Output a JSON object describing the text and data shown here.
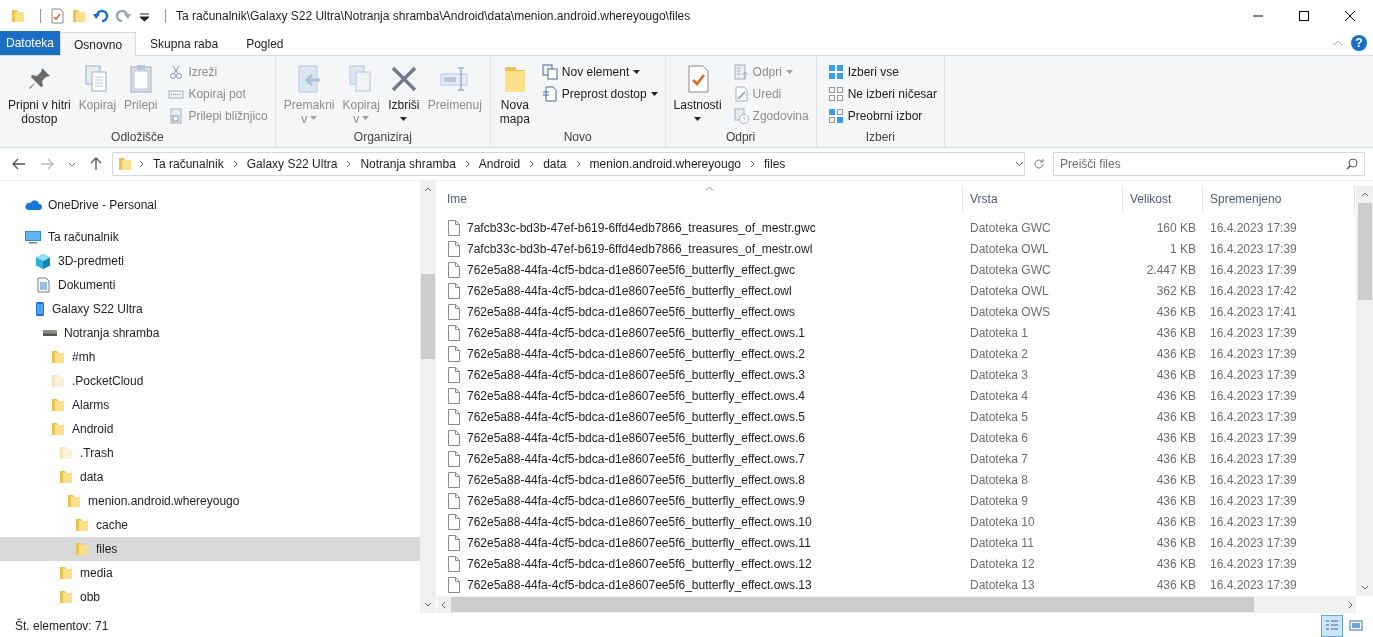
{
  "window": {
    "title": "Ta računalnik\\Galaxy S22 Ultra\\Notranja shramba\\Android\\data\\menion.android.whereyougo\\files"
  },
  "ribbon": {
    "tabs": [
      {
        "label": "Datoteka",
        "kind": "menu",
        "selected": false
      },
      {
        "label": "Osnovno",
        "kind": "tab",
        "selected": true
      },
      {
        "label": "Skupna raba",
        "kind": "tab",
        "selected": false
      },
      {
        "label": "Pogled",
        "kind": "tab",
        "selected": false
      }
    ],
    "help": "?",
    "groups": [
      {
        "label": "Odložišče",
        "items": [
          {
            "label": "Pripni v hitri\ndostop",
            "kind": "large",
            "disabled": false,
            "dropdown": false
          },
          {
            "label": "Kopiraj",
            "kind": "large",
            "disabled": true,
            "dropdown": false
          },
          {
            "label": "Prilepi",
            "kind": "large",
            "disabled": true,
            "dropdown": false
          },
          {
            "label": "Izreži",
            "kind": "small",
            "disabled": true,
            "dropdown": false
          },
          {
            "label": "Kopiraj pot",
            "kind": "small",
            "disabled": true,
            "dropdown": false
          },
          {
            "label": "Prilepi bližnjico",
            "kind": "small",
            "disabled": true,
            "dropdown": false
          }
        ]
      },
      {
        "label": "Organiziraj",
        "items": [
          {
            "label": "Premakni\nv",
            "kind": "large",
            "disabled": true,
            "dropdown": true
          },
          {
            "label": "Kopiraj\nv",
            "kind": "large",
            "disabled": true,
            "dropdown": true
          },
          {
            "label": "Izbriši",
            "kind": "large",
            "disabled": false,
            "dropdown": true
          },
          {
            "label": "Preimenuj",
            "kind": "large",
            "disabled": true,
            "dropdown": false
          }
        ]
      },
      {
        "label": "Novo",
        "items": [
          {
            "label": "Nova\nmapa",
            "kind": "large",
            "disabled": false,
            "dropdown": false
          },
          {
            "label": "Nov element",
            "kind": "small",
            "disabled": false,
            "dropdown": true
          },
          {
            "label": "Preprost dostop",
            "kind": "small",
            "disabled": false,
            "dropdown": true
          }
        ]
      },
      {
        "label": "Odpri",
        "items": [
          {
            "label": "Lastnosti",
            "kind": "large",
            "disabled": false,
            "dropdown": true
          },
          {
            "label": "Odpri",
            "kind": "small",
            "disabled": true,
            "dropdown": true
          },
          {
            "label": "Uredi",
            "kind": "small",
            "disabled": true,
            "dropdown": false
          },
          {
            "label": "Zgodovina",
            "kind": "small",
            "disabled": true,
            "dropdown": false
          }
        ]
      },
      {
        "label": "Izberi",
        "items": [
          {
            "label": "Izberi vse",
            "kind": "small",
            "disabled": false,
            "dropdown": false
          },
          {
            "label": "Ne izberi ničesar",
            "kind": "small",
            "disabled": false,
            "dropdown": false
          },
          {
            "label": "Preobrni izbor",
            "kind": "small",
            "disabled": false,
            "dropdown": false
          }
        ]
      }
    ]
  },
  "address": {
    "crumbs": [
      "Ta računalnik",
      "Galaxy S22 Ultra",
      "Notranja shramba",
      "Android",
      "data",
      "menion.android.whereyougo",
      "files"
    ]
  },
  "search": {
    "placeholder": "Preišči files"
  },
  "nav": {
    "tree": [
      {
        "label": "OneDrive - Personal",
        "kind": "cloud",
        "selected": false
      },
      {
        "label": "Ta računalnik",
        "kind": "pc",
        "selected": false,
        "children": [
          {
            "label": "3D-predmeti",
            "kind": "cube",
            "selected": false
          },
          {
            "label": "Dokumenti",
            "kind": "documents",
            "selected": false
          },
          {
            "label": "Galaxy S22 Ultra",
            "kind": "phone",
            "selected": false,
            "children": [
              {
                "label": "Notranja shramba",
                "kind": "drive",
                "selected": false,
                "children": [
                  {
                    "label": "#mh",
                    "kind": "folder",
                    "selected": false
                  },
                  {
                    "label": ".PocketCloud",
                    "kind": "hidden-folder",
                    "selected": false
                  },
                  {
                    "label": "Alarms",
                    "kind": "folder",
                    "selected": false
                  },
                  {
                    "label": "Android",
                    "kind": "folder",
                    "selected": false,
                    "children": [
                      {
                        "label": ".Trash",
                        "kind": "hidden-folder",
                        "selected": false
                      },
                      {
                        "label": "data",
                        "kind": "folder",
                        "selected": false,
                        "children": [
                          {
                            "label": "menion.android.whereyougo",
                            "kind": "folder",
                            "selected": false,
                            "children": [
                              {
                                "label": "cache",
                                "kind": "folder",
                                "selected": false
                              },
                              {
                                "label": "files",
                                "kind": "folder",
                                "selected": true
                              }
                            ]
                          }
                        ]
                      },
                      {
                        "label": "media",
                        "kind": "folder",
                        "selected": false
                      },
                      {
                        "label": "obb",
                        "kind": "folder",
                        "selected": false
                      }
                    ]
                  }
                ]
              }
            ]
          }
        ]
      }
    ]
  },
  "file_list": {
    "columns": [
      {
        "label": "Ime",
        "sorted": true
      },
      {
        "label": "Vrsta",
        "sorted": false
      },
      {
        "label": "Velikost",
        "sorted": false
      },
      {
        "label": "Spremenjeno",
        "sorted": false
      }
    ],
    "rows": [
      {
        "name": "7afcb33c-bd3b-47ef-b619-6ffd4edb7866_treasures_of_mestr.gwc",
        "type": "Datoteka GWC",
        "size": "160 KB",
        "modified": "16.4.2023 17:39"
      },
      {
        "name": "7afcb33c-bd3b-47ef-b619-6ffd4edb7866_treasures_of_mestr.owl",
        "type": "Datoteka OWL",
        "size": "1 KB",
        "modified": "16.4.2023 17:39"
      },
      {
        "name": "762e5a88-44fa-4cf5-bdca-d1e8607ee5f6_butterfly_effect.gwc",
        "type": "Datoteka GWC",
        "size": "2.447 KB",
        "modified": "16.4.2023 17:39"
      },
      {
        "name": "762e5a88-44fa-4cf5-bdca-d1e8607ee5f6_butterfly_effect.owl",
        "type": "Datoteka OWL",
        "size": "362 KB",
        "modified": "16.4.2023 17:42"
      },
      {
        "name": "762e5a88-44fa-4cf5-bdca-d1e8607ee5f6_butterfly_effect.ows",
        "type": "Datoteka OWS",
        "size": "436 KB",
        "modified": "16.4.2023 17:41"
      },
      {
        "name": "762e5a88-44fa-4cf5-bdca-d1e8607ee5f6_butterfly_effect.ows.1",
        "type": "Datoteka 1",
        "size": "436 KB",
        "modified": "16.4.2023 17:39"
      },
      {
        "name": "762e5a88-44fa-4cf5-bdca-d1e8607ee5f6_butterfly_effect.ows.2",
        "type": "Datoteka 2",
        "size": "436 KB",
        "modified": "16.4.2023 17:39"
      },
      {
        "name": "762e5a88-44fa-4cf5-bdca-d1e8607ee5f6_butterfly_effect.ows.3",
        "type": "Datoteka 3",
        "size": "436 KB",
        "modified": "16.4.2023 17:39"
      },
      {
        "name": "762e5a88-44fa-4cf5-bdca-d1e8607ee5f6_butterfly_effect.ows.4",
        "type": "Datoteka 4",
        "size": "436 KB",
        "modified": "16.4.2023 17:39"
      },
      {
        "name": "762e5a88-44fa-4cf5-bdca-d1e8607ee5f6_butterfly_effect.ows.5",
        "type": "Datoteka 5",
        "size": "436 KB",
        "modified": "16.4.2023 17:39"
      },
      {
        "name": "762e5a88-44fa-4cf5-bdca-d1e8607ee5f6_butterfly_effect.ows.6",
        "type": "Datoteka 6",
        "size": "436 KB",
        "modified": "16.4.2023 17:39"
      },
      {
        "name": "762e5a88-44fa-4cf5-bdca-d1e8607ee5f6_butterfly_effect.ows.7",
        "type": "Datoteka 7",
        "size": "436 KB",
        "modified": "16.4.2023 17:39"
      },
      {
        "name": "762e5a88-44fa-4cf5-bdca-d1e8607ee5f6_butterfly_effect.ows.8",
        "type": "Datoteka 8",
        "size": "436 KB",
        "modified": "16.4.2023 17:39"
      },
      {
        "name": "762e5a88-44fa-4cf5-bdca-d1e8607ee5f6_butterfly_effect.ows.9",
        "type": "Datoteka 9",
        "size": "436 KB",
        "modified": "16.4.2023 17:39"
      },
      {
        "name": "762e5a88-44fa-4cf5-bdca-d1e8607ee5f6_butterfly_effect.ows.10",
        "type": "Datoteka 10",
        "size": "436 KB",
        "modified": "16.4.2023 17:39"
      },
      {
        "name": "762e5a88-44fa-4cf5-bdca-d1e8607ee5f6_butterfly_effect.ows.11",
        "type": "Datoteka 11",
        "size": "436 KB",
        "modified": "16.4.2023 17:39"
      },
      {
        "name": "762e5a88-44fa-4cf5-bdca-d1e8607ee5f6_butterfly_effect.ows.12",
        "type": "Datoteka 12",
        "size": "436 KB",
        "modified": "16.4.2023 17:39"
      },
      {
        "name": "762e5a88-44fa-4cf5-bdca-d1e8607ee5f6_butterfly_effect.ows.13",
        "type": "Datoteka 13",
        "size": "436 KB",
        "modified": "16.4.2023 17:39"
      }
    ]
  },
  "status_bar": {
    "text": "Št. elementov: 71",
    "views": [
      {
        "kind": "details",
        "selected": true
      },
      {
        "kind": "large-icons",
        "selected": false
      }
    ]
  }
}
